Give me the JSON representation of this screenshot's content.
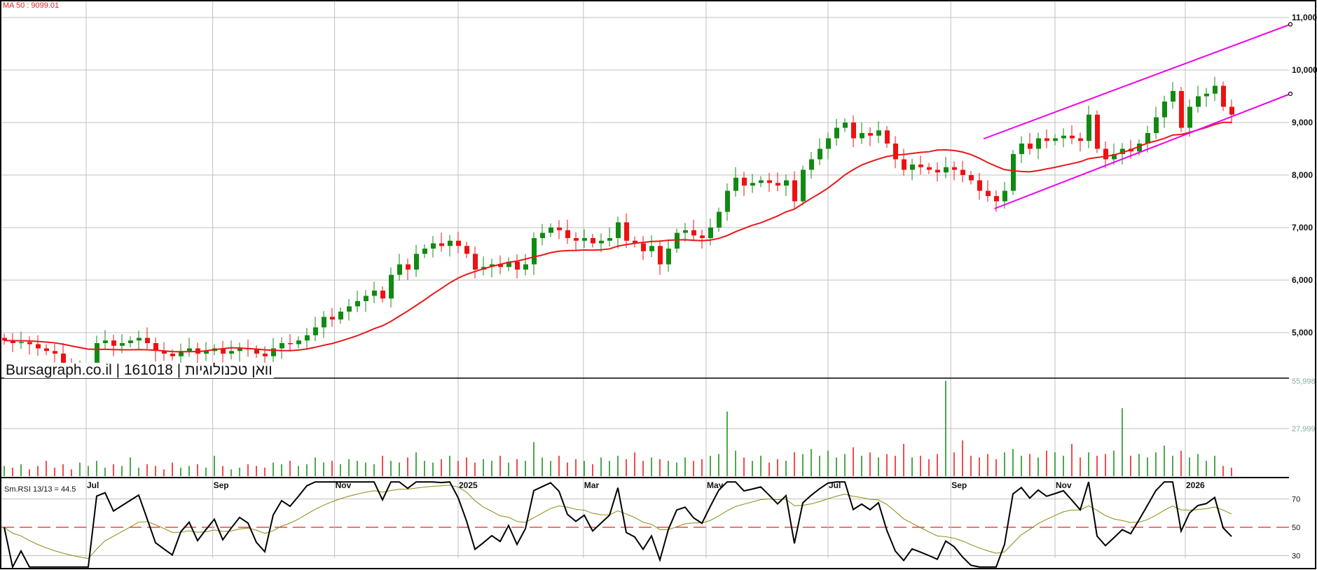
{
  "chart_data": {
    "type": "candlestick",
    "title": "Bursagraph.co.il | 161018 | וואן טכנולוגיות",
    "ma_label": "MA 50 : 9099.01",
    "rsi_label": "Sm.RSI 13/13 = 44.5",
    "price_axis": {
      "ticks": [
        "11,000",
        "10,000",
        "9,000",
        "8,000",
        "7,000",
        "6,000",
        "5,000"
      ],
      "values": [
        11000,
        10000,
        9000,
        8000,
        7000,
        6000,
        5000
      ],
      "ylim": [
        3000,
        11330
      ]
    },
    "volume_axis": {
      "ticks": [
        "55,998",
        "27,999"
      ],
      "values": [
        55998,
        27999
      ]
    },
    "rsi_axis": {
      "ticks": [
        "70",
        "50",
        "30"
      ],
      "values": [
        70,
        50,
        30
      ]
    },
    "months": [
      {
        "label": "Jul",
        "x": 9.75
      },
      {
        "label": "Sep",
        "x": 24.8
      },
      {
        "label": "Nov",
        "x": 39.3
      },
      {
        "label": "2025",
        "x": 54
      },
      {
        "label": "Mar",
        "x": 68.9
      },
      {
        "label": "May",
        "x": 83.5
      },
      {
        "label": "Jul",
        "x": 98
      },
      {
        "label": "Sep",
        "x": 112.6
      },
      {
        "label": "Nov",
        "x": 125
      },
      {
        "label": "2026",
        "x": 140.5
      }
    ],
    "closes": [
      4850,
      4800,
      4820,
      4780,
      4700,
      4650,
      4600,
      4400,
      4300,
      4300,
      4350,
      4800,
      4850,
      4750,
      4800,
      4850,
      4900,
      4800,
      4650,
      4600,
      4550,
      4650,
      4700,
      4600,
      4650,
      4700,
      4600,
      4650,
      4700,
      4680,
      4600,
      4550,
      4700,
      4800,
      4780,
      4850,
      4950,
      5100,
      5300,
      5250,
      5400,
      5500,
      5600,
      5700,
      5800,
      5650,
      6100,
      6300,
      6200,
      6500,
      6600,
      6700,
      6650,
      6750,
      6650,
      6500,
      6200,
      6250,
      6300,
      6250,
      6350,
      6200,
      6300,
      6800,
      6900,
      7000,
      6950,
      6800,
      6750,
      6800,
      6700,
      6750,
      6800,
      7100,
      6750,
      6700,
      6550,
      6650,
      6300,
      6600,
      6900,
      6950,
      6850,
      6800,
      7000,
      7300,
      7700,
      7950,
      7800,
      7850,
      7900,
      7850,
      7800,
      7900,
      7500,
      8100,
      8300,
      8500,
      8700,
      8900,
      9000,
      8700,
      8800,
      8750,
      8850,
      8600,
      8300,
      8100,
      8200,
      8150,
      8100,
      8050,
      8150,
      8100,
      8000,
      7900,
      7700,
      7600,
      7500,
      7700,
      8400,
      8600,
      8500,
      8700,
      8650,
      8700,
      8750,
      8700,
      8650,
      9150,
      8500,
      8300,
      8400,
      8500,
      8450,
      8600,
      8800,
      9100,
      9400,
      9600,
      8900,
      9300,
      9500,
      9550,
      9700,
      9300,
      9150
    ],
    "volumes": [
      6000,
      5000,
      7000,
      4000,
      6000,
      9000,
      5000,
      7000,
      4000,
      8000,
      6000,
      9000,
      5000,
      7000,
      6000,
      11000,
      5000,
      7000,
      6000,
      4000,
      8000,
      5000,
      6000,
      7000,
      5000,
      12000,
      6000,
      4000,
      5000,
      7000,
      6000,
      5000,
      8000,
      7000,
      9000,
      6000,
      7000,
      11000,
      8000,
      9000,
      7000,
      10000,
      9000,
      8000,
      7000,
      12000,
      9000,
      8000,
      11000,
      14000,
      9000,
      8000,
      10000,
      12000,
      9000,
      11000,
      8000,
      10000,
      9000,
      12000,
      8000,
      10000,
      9000,
      20000,
      11000,
      9000,
      12000,
      8000,
      10000,
      9000,
      7000,
      11000,
      9000,
      12000,
      10000,
      14000,
      9000,
      11000,
      10000,
      9000,
      8000,
      11000,
      9000,
      10000,
      12000,
      13000,
      38000,
      15000,
      11000,
      9000,
      12000,
      8000,
      10000,
      9000,
      14000,
      13000,
      16000,
      12000,
      15000,
      11000,
      13000,
      17000,
      12000,
      14000,
      11000,
      13000,
      12000,
      19000,
      11000,
      12000,
      10000,
      13000,
      55998,
      14000,
      21000,
      12000,
      11000,
      13000,
      10000,
      14000,
      16000,
      12000,
      13000,
      11000,
      15000,
      14000,
      12000,
      19000,
      11000,
      14000,
      12000,
      13000,
      15000,
      40000,
      12000,
      13000,
      11000,
      14000,
      18000,
      12000,
      15000,
      11000,
      13000,
      9000,
      12000,
      6000,
      5000
    ],
    "channel": {
      "upper": {
        "x1": 116.5,
        "y1": 8690,
        "x2": 153,
        "y2": 10870
      },
      "lower": {
        "x1": 117.8,
        "y1": 7360,
        "x2": 153,
        "y2": 9547
      }
    },
    "colors": {
      "up": "#118a11",
      "down": "#ee1111",
      "ma": "#e81818",
      "channel": "#ee00ee",
      "rsi": "#000000",
      "signal": "#8a8a10",
      "grid": "#c0c0c0"
    }
  }
}
